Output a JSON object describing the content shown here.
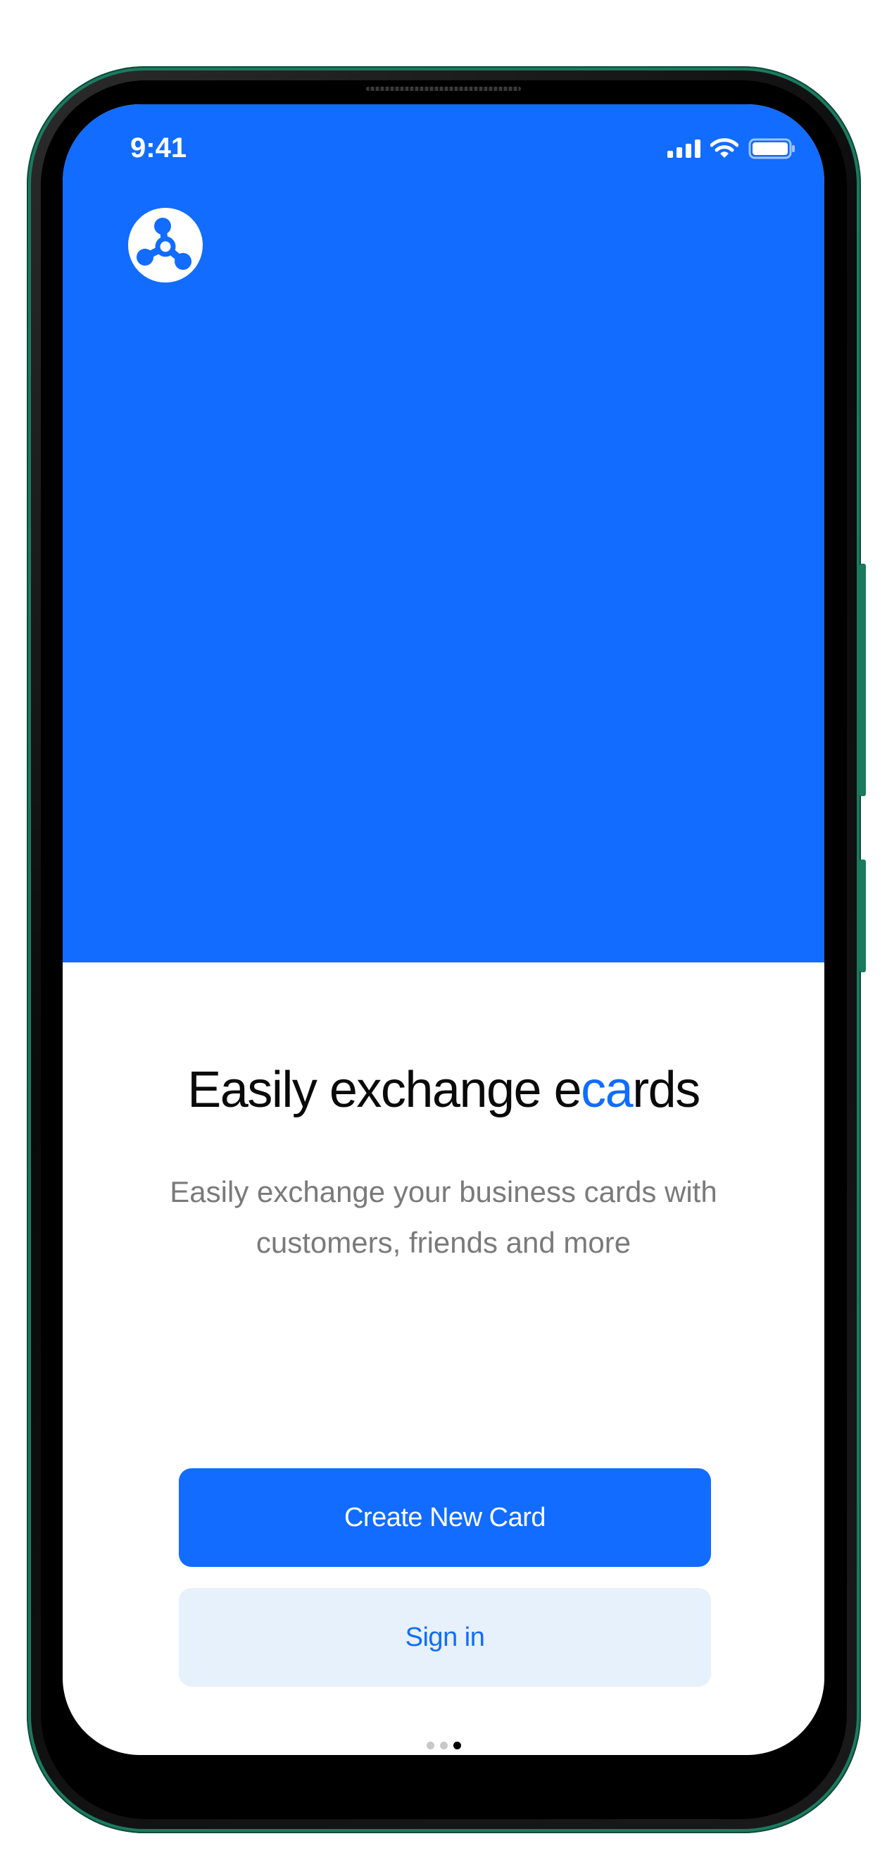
{
  "status_bar": {
    "time": "9:41",
    "icons": [
      "cellular-signal-icon",
      "wifi-icon",
      "battery-icon"
    ]
  },
  "app": {
    "logo_icon": "network-nodes-logo-icon"
  },
  "onboarding": {
    "headline_part1": "Easily exchange e",
    "headline_accent": "ca",
    "headline_part2": "rds",
    "subtitle": "Easily exchange your business cards with customers, friends and more",
    "primary_button": "Create New Card",
    "secondary_button": "Sign in",
    "page_indicator": {
      "total": 3,
      "active_index": 2
    }
  },
  "colors": {
    "brand_blue": "#116cff",
    "secondary_button_bg": "#e6f1fb",
    "frame_green": "#1b7a5e"
  }
}
